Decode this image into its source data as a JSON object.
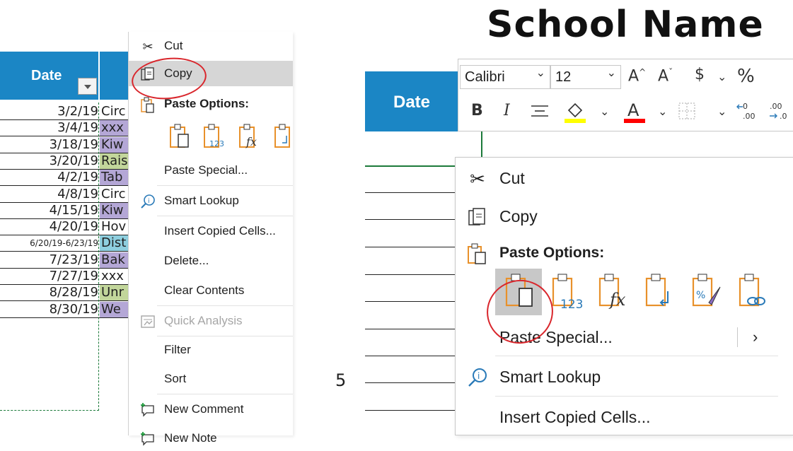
{
  "left_sheet": {
    "header_date": "Date",
    "rows": [
      {
        "date": "3/2/19",
        "desc": "Circ",
        "color": "#ffffff"
      },
      {
        "date": "3/4/19",
        "desc": "xxx",
        "color": "#b4a7d6"
      },
      {
        "date": "3/18/19",
        "desc": "Kiw",
        "color": "#b4a7d6"
      },
      {
        "date": "3/20/19",
        "desc": "Rais",
        "color": "#c2d69b"
      },
      {
        "date": "4/2/19",
        "desc": "Tab",
        "color": "#b4a7d6"
      },
      {
        "date": "4/8/19",
        "desc": "Circ",
        "color": "#ffffff"
      },
      {
        "date": "4/15/19",
        "desc": "Kiw",
        "color": "#b4a7d6"
      },
      {
        "date": "4/20/19",
        "desc": "Hov",
        "color": "#ffffff"
      },
      {
        "date": "6/20/19-6/23/19",
        "desc": "Dist",
        "color": "#8ecfdf"
      },
      {
        "date": "7/23/19",
        "desc": "Bak",
        "color": "#b4a7d6"
      },
      {
        "date": "7/27/19",
        "desc": "xxx",
        "color": "#ffffff"
      },
      {
        "date": "8/28/19",
        "desc": "Unr",
        "color": "#c2d69b"
      },
      {
        "date": "8/30/19",
        "desc": "We",
        "color": "#b4a7d6"
      }
    ]
  },
  "left_menu": {
    "cut": "Cut",
    "copy": "Copy",
    "paste_options": "Paste Options:",
    "paste_special": "Paste Special...",
    "smart_lookup": "Smart Lookup",
    "insert_copied": "Insert Copied Cells...",
    "delete": "Delete...",
    "clear_contents": "Clear Contents",
    "quick_analysis": "Quick Analysis",
    "filter": "Filter",
    "sort": "Sort",
    "new_comment": "New Comment",
    "new_note": "New Note"
  },
  "right": {
    "title": "School Name",
    "header_date": "Date",
    "row_number": "5",
    "toolbar": {
      "font": "Calibri",
      "size": "12",
      "bold": "B",
      "italic": "I",
      "dollar": "$",
      "percent": "%",
      "highlight_color": "#ffff00",
      "font_color": "#ff0000"
    },
    "menu": {
      "cut": "Cut",
      "copy": "Copy",
      "paste_options": "Paste Options:",
      "paste_special": "Paste Special...",
      "smart_lookup": "Smart Lookup",
      "insert_copied": "Insert Copied Cells..."
    }
  },
  "colors": {
    "header_blue": "#1b86c5",
    "annotation_red": "#d9262c",
    "icon_orange": "#e8912b",
    "icon_blue": "#2a7ab8"
  }
}
